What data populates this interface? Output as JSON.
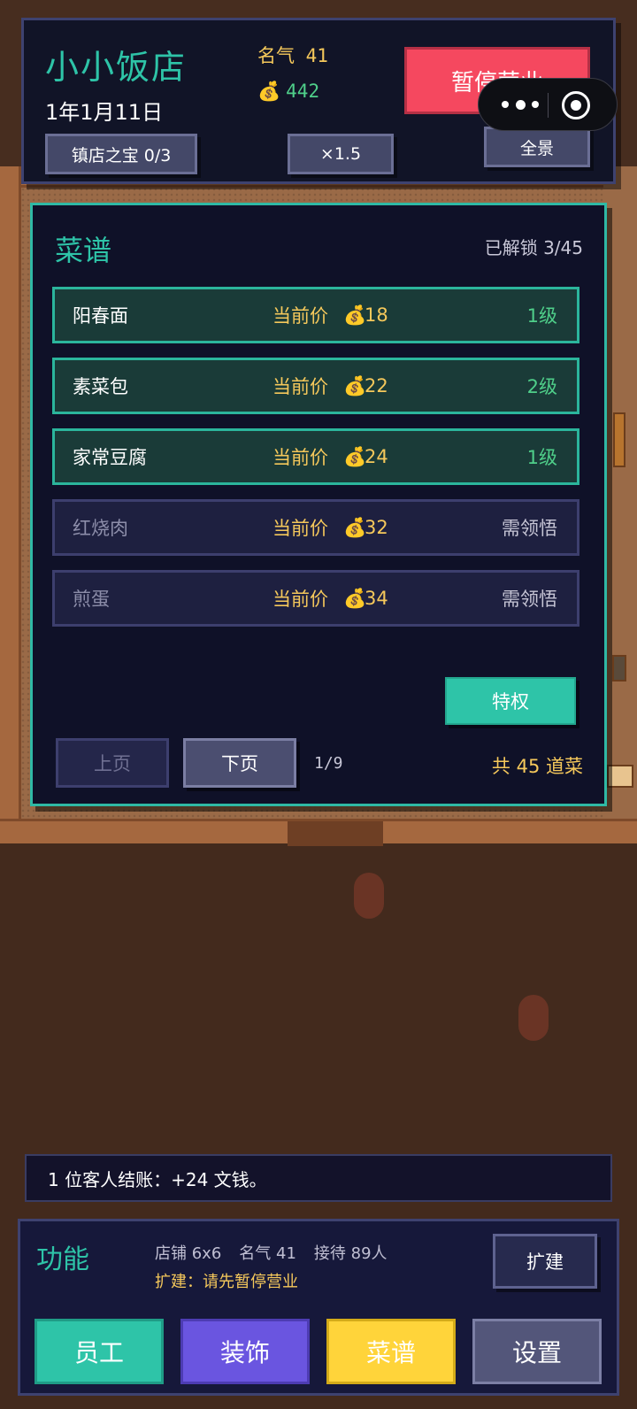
{
  "header": {
    "shop_name": "小小饭店",
    "date": "1年1月11日",
    "fame": "名气 41",
    "money": "442",
    "money_icon": "money-bag-icon",
    "pause_button": "暂停营业",
    "treasure_button": "镇店之宝 0/3",
    "speed_button": "×1.5",
    "panorama_button": "全景"
  },
  "recipe_dialog": {
    "title": "菜谱",
    "unlocked_count": "已解锁 3/45",
    "price_label": "当前价",
    "recipes": [
      {
        "name": "阳春面",
        "price": "18",
        "status": "1级",
        "unlocked": true
      },
      {
        "name": "素菜包",
        "price": "22",
        "status": "2级",
        "unlocked": true
      },
      {
        "name": "家常豆腐",
        "price": "24",
        "status": "1级",
        "unlocked": true
      },
      {
        "name": "红烧肉",
        "price": "32",
        "status": "需领悟",
        "unlocked": false
      },
      {
        "name": "煎蛋",
        "price": "34",
        "status": "需领悟",
        "unlocked": false
      }
    ],
    "privilege_button": "特权",
    "prev_button": "上页",
    "next_button": "下页",
    "page_indicator": "1/9",
    "total_text": "共 45 道菜"
  },
  "log": {
    "message": "1 位客人结账：+24 文钱。"
  },
  "function_panel": {
    "title": "功能",
    "shop_size": "店铺 6x6",
    "fame": "名气 41",
    "capacity": "接待 89人",
    "expand_hint": "扩建：请先暂停营业",
    "expand_button": "扩建",
    "buttons": {
      "staff": "员工",
      "decor": "装饰",
      "recipe": "菜谱",
      "settings": "设置"
    }
  },
  "colors": {
    "accent_teal": "#2ec4a8",
    "pause_red": "#f5485f",
    "gold": "#f5c85b",
    "green_level": "#4fcf8a",
    "decor_purple": "#6a55e0",
    "recipe_yellow": "#ffd43a"
  }
}
